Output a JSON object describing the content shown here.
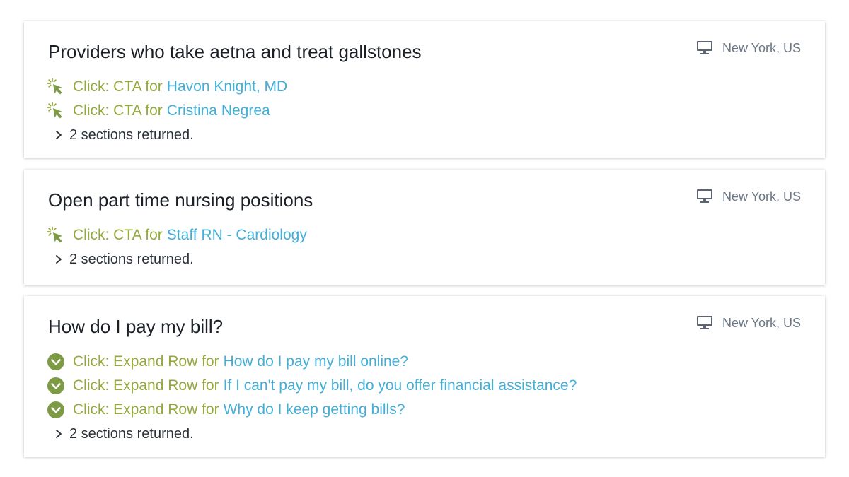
{
  "colors": {
    "action": "#93a93a",
    "target": "#43afd8",
    "query": "#1b1f26",
    "location": "#6b7684",
    "icon_green": "#7d9b45"
  },
  "sessions": [
    {
      "query": "Providers who take aetna and treat gallstones",
      "location": "New York, US",
      "device_icon": "desktop-monitor-icon",
      "events": [
        {
          "icon": "cursor-click-icon",
          "action": "Click: CTA for",
          "target": "Havon Knight, MD"
        },
        {
          "icon": "cursor-click-icon",
          "action": "Click: CTA for",
          "target": "Cristina Negrea"
        }
      ],
      "sections_returned": "2 sections returned."
    },
    {
      "query": "Open part time nursing positions",
      "location": "New York, US",
      "device_icon": "desktop-monitor-icon",
      "events": [
        {
          "icon": "cursor-click-icon",
          "action": "Click: CTA for",
          "target": "Staff RN - Cardiology"
        }
      ],
      "sections_returned": "2 sections returned."
    },
    {
      "query": "How do I pay my bill?",
      "location": "New York, US",
      "device_icon": "desktop-monitor-icon",
      "events": [
        {
          "icon": "expand-row-icon",
          "action": "Click: Expand Row for",
          "target": "How do I pay my bill online?"
        },
        {
          "icon": "expand-row-icon",
          "action": "Click: Expand Row for",
          "target": "If I can't pay my bill, do you offer financial assistance?"
        },
        {
          "icon": "expand-row-icon",
          "action": "Click: Expand Row for",
          "target": "Why do I keep getting bills?"
        }
      ],
      "sections_returned": "2 sections returned."
    }
  ]
}
